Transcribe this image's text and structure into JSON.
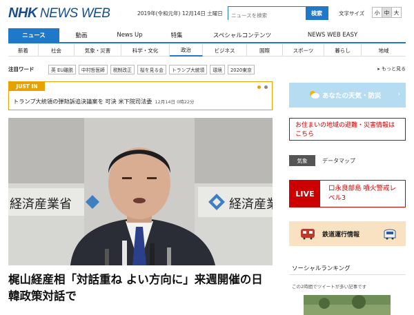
{
  "header": {
    "logo_nhk": "NHK",
    "logo_news": "NEWS WEB",
    "date": "2019年(令和元年) 12月14日 土曜日",
    "search_placeholder": "ニュースを検索",
    "search_button": "検索",
    "font_size_label": "文字サイズ",
    "font_sizes": [
      "小",
      "中",
      "大"
    ]
  },
  "main_nav": [
    {
      "label": "ニュース"
    },
    {
      "label": "動画"
    },
    {
      "label": "News Up"
    },
    {
      "label": "特集"
    },
    {
      "label": "スペシャルコンテンツ"
    },
    {
      "label": "NEWS WEB EASY"
    }
  ],
  "sub_nav": [
    {
      "label": "新着"
    },
    {
      "label": "社会"
    },
    {
      "label": "気象・災害"
    },
    {
      "label": "科学・文化"
    },
    {
      "label": "政治"
    },
    {
      "label": "ビジネス"
    },
    {
      "label": "国際"
    },
    {
      "label": "スポーツ"
    },
    {
      "label": "暮らし"
    },
    {
      "label": "地域"
    }
  ],
  "keywords": {
    "title": "注目ワード",
    "items": [
      "英 EU離脱",
      "中村哲医師",
      "税制改正",
      "桜を見る会",
      "トランプ大統領",
      "環境",
      "2020東京"
    ],
    "more": "もっと見る"
  },
  "just_in": {
    "label": "JUST IN",
    "headline": "トランプ大統領の弾劾訴追決議案を 可決 米下院司法委",
    "time": "12月14日 0時22分"
  },
  "main_story": {
    "photo_sign_left": "経済産業省",
    "photo_sign_right": "経済産業",
    "headline": "梶山経産相「対話重ね よい方向に」来週開催の日韓政策対話で"
  },
  "sidebar": {
    "weather": "あなたの天気・防災",
    "evacuation": "お住まいの地域の避難・災害情報はこちら",
    "kishou_tag": "気象",
    "kishou_link": "データマップ",
    "live_tag": "LIVE",
    "live_text": "口永良部島 噴火警戒レベル3",
    "train": "鉄道運行情報",
    "social_title": "ソーシャルランキング",
    "social_desc": "この2時間でツイートが多い記事です"
  },
  "colors": {
    "brand_blue": "#1f78c8",
    "justin_orange": "#e8a200",
    "alert_red": "#cc0000"
  }
}
